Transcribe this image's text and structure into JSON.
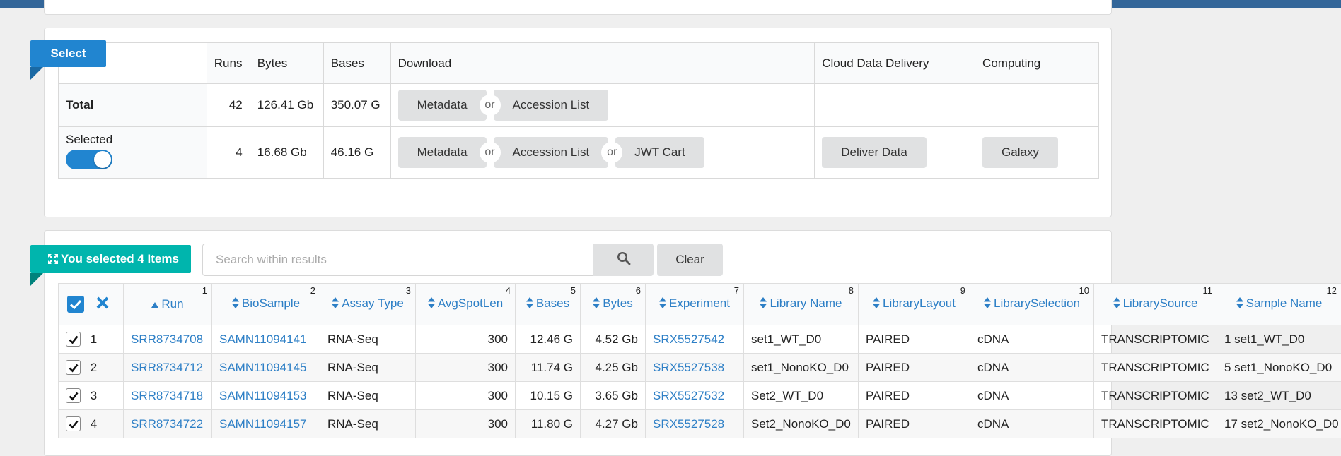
{
  "select_card": {
    "ribbon_label": "Select",
    "headers": [
      "Runs",
      "Bytes",
      "Bases",
      "Download",
      "Cloud Data Delivery",
      "Computing"
    ],
    "total": {
      "label": "Total",
      "runs": "42",
      "bytes": "126.41 Gb",
      "bases": "350.07 G",
      "metadata_label": "Metadata",
      "or_label": "or",
      "accession_label": "Accession List"
    },
    "selected": {
      "label": "Selected",
      "runs": "4",
      "bytes": "16.68 Gb",
      "bases": "46.16 G",
      "metadata_label": "Metadata",
      "or_label": "or",
      "accession_label": "Accession List",
      "jwt_label": "JWT Cart",
      "deliver_label": "Deliver Data",
      "galaxy_label": "Galaxy",
      "toggle_on": true
    }
  },
  "results": {
    "ribbon_label": "You selected 4 Items",
    "search_placeholder": "Search within results",
    "clear_label": "Clear",
    "columns": [
      {
        "num": "1",
        "label": "Run"
      },
      {
        "num": "2",
        "label": "BioSample"
      },
      {
        "num": "3",
        "label": "Assay Type"
      },
      {
        "num": "4",
        "label": "AvgSpotLen"
      },
      {
        "num": "5",
        "label": "Bases"
      },
      {
        "num": "6",
        "label": "Bytes"
      },
      {
        "num": "7",
        "label": "Experiment"
      },
      {
        "num": "8",
        "label": "Library Name"
      },
      {
        "num": "9",
        "label": "LibraryLayout"
      },
      {
        "num": "10",
        "label": "LibrarySelection"
      },
      {
        "num": "11",
        "label": "LibrarySource"
      },
      {
        "num": "12",
        "label": "Sample Name"
      }
    ],
    "rows": [
      {
        "index": "1",
        "run": "SRR8734708",
        "biosample": "SAMN11094141",
        "assay": "RNA-Seq",
        "avgspot": "300",
        "bases": "12.46 G",
        "bytes": "4.52 Gb",
        "experiment": "SRX5527542",
        "library_name": "set1_WT_D0",
        "layout": "PAIRED",
        "selection": "cDNA",
        "source": "TRANSCRIPTOMIC",
        "sample_name": "1 set1_WT_D0"
      },
      {
        "index": "2",
        "run": "SRR8734712",
        "biosample": "SAMN11094145",
        "assay": "RNA-Seq",
        "avgspot": "300",
        "bases": "11.74 G",
        "bytes": "4.25 Gb",
        "experiment": "SRX5527538",
        "library_name": "set1_NonoKO_D0",
        "layout": "PAIRED",
        "selection": "cDNA",
        "source": "TRANSCRIPTOMIC",
        "sample_name": "5 set1_NonoKO_D0"
      },
      {
        "index": "3",
        "run": "SRR8734718",
        "biosample": "SAMN11094153",
        "assay": "RNA-Seq",
        "avgspot": "300",
        "bases": "10.15 G",
        "bytes": "3.65 Gb",
        "experiment": "SRX5527532",
        "library_name": "Set2_WT_D0",
        "layout": "PAIRED",
        "selection": "cDNA",
        "source": "TRANSCRIPTOMIC",
        "sample_name": "13 set2_WT_D0"
      },
      {
        "index": "4",
        "run": "SRR8734722",
        "biosample": "SAMN11094157",
        "assay": "RNA-Seq",
        "avgspot": "300",
        "bases": "11.80 G",
        "bytes": "4.27 Gb",
        "experiment": "SRX5527528",
        "library_name": "Set2_NonoKO_D0",
        "layout": "PAIRED",
        "selection": "cDNA",
        "source": "TRANSCRIPTOMIC",
        "sample_name": "17 set2_NonoKO_D0"
      }
    ]
  },
  "colors": {
    "top_bar": "#336699",
    "select_ribbon": "#2185d0",
    "results_ribbon": "#00b5ad",
    "link": "#2d7fc6",
    "toggle": "#2185d0",
    "button": "#e0e1e2"
  }
}
